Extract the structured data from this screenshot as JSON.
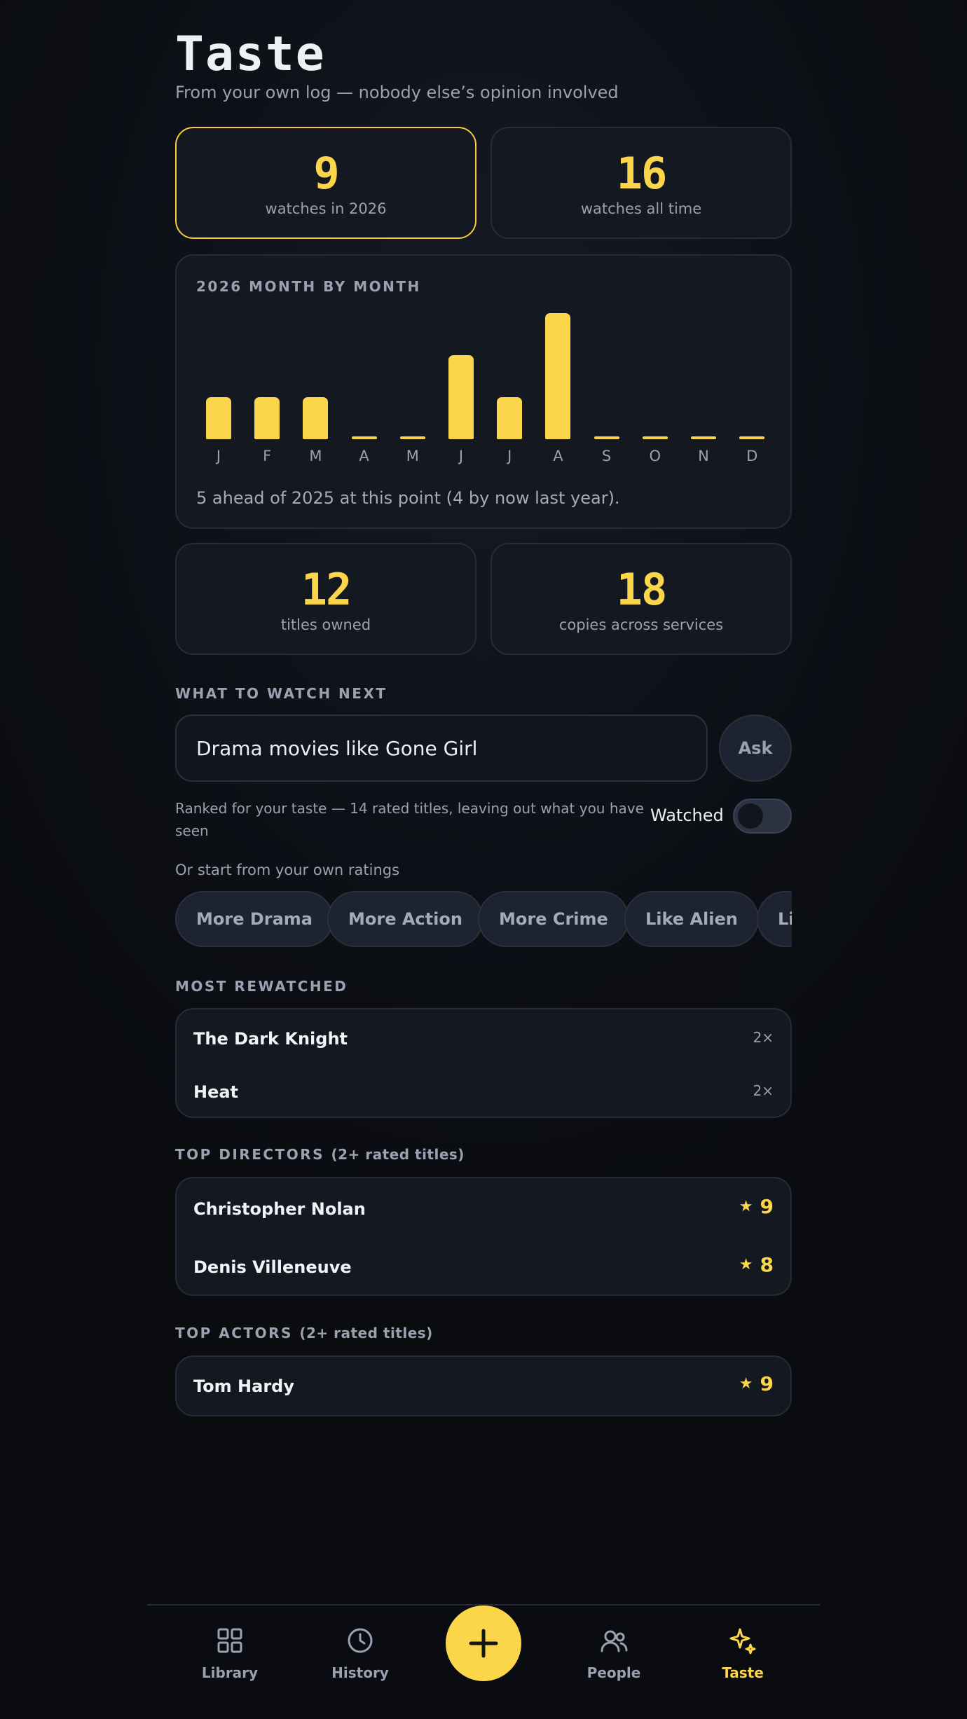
{
  "header": {
    "title": "Taste",
    "subtitle": "From your own log — nobody else’s opinion involved"
  },
  "stats_top": [
    {
      "value": "9",
      "label": "watches in 2026"
    },
    {
      "value": "16",
      "label": "watches all time"
    }
  ],
  "chart_data": {
    "type": "bar",
    "title": "2026 MONTH BY MONTH",
    "categories": [
      "J",
      "F",
      "M",
      "A",
      "M",
      "J",
      "J",
      "A",
      "S",
      "O",
      "N",
      "D"
    ],
    "values": [
      1,
      1,
      1,
      0,
      0,
      2,
      1,
      3,
      0,
      0,
      0,
      0
    ],
    "ylim": [
      0,
      3
    ],
    "grid": false,
    "note": "5 ahead of 2025 at this point (4 by now last year)."
  },
  "stats_mid": [
    {
      "value": "12",
      "label": "titles owned"
    },
    {
      "value": "18",
      "label": "copies across services"
    }
  ],
  "watch_next": {
    "section_label": "WHAT TO WATCH NEXT",
    "input_value": "Drama movies like Gone Girl",
    "ask_label": "Ask",
    "ranked_text": "Ranked for your taste — 14 rated titles, leaving out what you have seen",
    "watched_label": "Watched",
    "watched_on": false,
    "or_start": "Or start from your own ratings",
    "chips": [
      "More Drama",
      "More Action",
      "More Crime",
      "Like Alien",
      "Li"
    ]
  },
  "most_rewatched": {
    "label": "MOST REWATCHED",
    "items": [
      {
        "name": "The Dark Knight",
        "count": "2×"
      },
      {
        "name": "Heat",
        "count": "2×"
      }
    ]
  },
  "top_directors": {
    "label": "TOP DIRECTORS",
    "sub": "(2+ rated titles)",
    "items": [
      {
        "name": "Christopher Nolan",
        "score": "9"
      },
      {
        "name": "Denis Villeneuve",
        "score": "8"
      }
    ]
  },
  "top_actors": {
    "label": "TOP ACTORS",
    "sub": "(2+ rated titles)",
    "items": [
      {
        "name": "Tom Hardy",
        "score": "9"
      }
    ]
  },
  "nav": {
    "items": [
      {
        "label": "Library",
        "icon": "grid-icon"
      },
      {
        "label": "History",
        "icon": "clock-icon"
      },
      {
        "label": "People",
        "icon": "people-icon"
      },
      {
        "label": "Taste",
        "icon": "sparkle-icon",
        "active": true
      }
    ],
    "fab_icon": "plus-icon"
  },
  "colors": {
    "accent": "#fcd64a",
    "background": "#0b0d12",
    "card": "#141821"
  }
}
